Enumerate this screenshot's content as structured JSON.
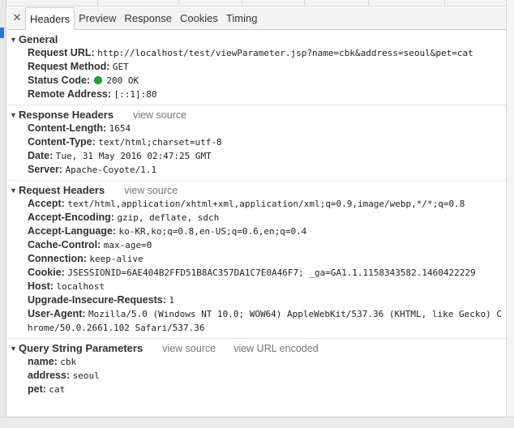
{
  "tabs": {
    "close_icon": "close-icon",
    "items": [
      "Headers",
      "Preview",
      "Response",
      "Cookies",
      "Timing"
    ]
  },
  "general": {
    "title": "General",
    "rows": [
      {
        "key": "Request URL:",
        "value": "http://localhost/test/viewParameter.jsp?name=cbk&address=seoul&pet=cat"
      },
      {
        "key": "Request Method:",
        "value": "GET"
      },
      {
        "key": "Status Code:",
        "value": "200 OK",
        "status_color": "#1fa33a"
      },
      {
        "key": "Remote Address:",
        "value": "[::1]:80"
      }
    ]
  },
  "response_headers": {
    "title": "Response Headers",
    "view_source": "view source",
    "rows": [
      {
        "key": "Content-Length:",
        "value": "1654"
      },
      {
        "key": "Content-Type:",
        "value": "text/html;charset=utf-8"
      },
      {
        "key": "Date:",
        "value": "Tue, 31 May 2016 02:47:25 GMT"
      },
      {
        "key": "Server:",
        "value": "Apache-Coyote/1.1"
      }
    ]
  },
  "request_headers": {
    "title": "Request Headers",
    "view_source": "view source",
    "rows": [
      {
        "key": "Accept:",
        "value": "text/html,application/xhtml+xml,application/xml;q=0.9,image/webp,*/*;q=0.8"
      },
      {
        "key": "Accept-Encoding:",
        "value": "gzip, deflate, sdch"
      },
      {
        "key": "Accept-Language:",
        "value": "ko-KR,ko;q=0.8,en-US;q=0.6,en;q=0.4"
      },
      {
        "key": "Cache-Control:",
        "value": "max-age=0"
      },
      {
        "key": "Connection:",
        "value": "keep-alive"
      },
      {
        "key": "Cookie:",
        "value": "JSESSIONID=6AE404B2FFD51B8AC357DA1C7E0A46F7; _ga=GA1.1.1158343582.1460422229"
      },
      {
        "key": "Host:",
        "value": "localhost"
      },
      {
        "key": "Upgrade-Insecure-Requests:",
        "value": "1"
      },
      {
        "key": "User-Agent:",
        "value": "Mozilla/5.0 (Windows NT 10.0; WOW64) AppleWebKit/537.36 (KHTML, like Gecko) Chrome/50.0.2661.102 Safari/537.36"
      }
    ]
  },
  "query_string": {
    "title": "Query String Parameters",
    "view_source": "view source",
    "view_url_encoded": "view URL encoded",
    "rows": [
      {
        "key": "name:",
        "value": "cbk"
      },
      {
        "key": "address:",
        "value": "seoul"
      },
      {
        "key": "pet:",
        "value": "cat"
      }
    ]
  }
}
